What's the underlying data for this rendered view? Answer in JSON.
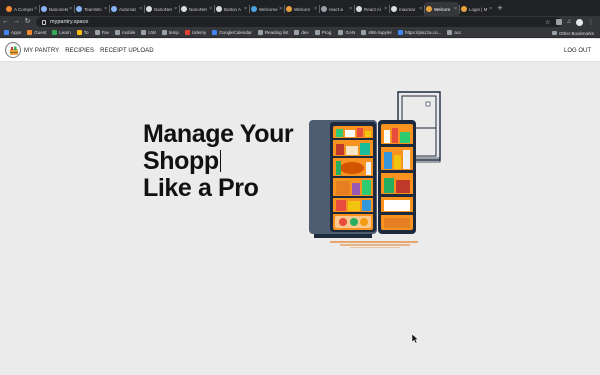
{
  "browser": {
    "tabs": [
      {
        "title": "A Compre",
        "icon": "orange-dot-icon",
        "color": "#f28b30"
      },
      {
        "title": "Nanonets",
        "icon": "nanonets-icon",
        "color": "#8ab4f8"
      },
      {
        "title": "TeamWo",
        "icon": "nanonets-icon",
        "color": "#8ab4f8"
      },
      {
        "title": "Automat",
        "icon": "nanonets-icon",
        "color": "#8ab4f8"
      },
      {
        "title": "NanoNet",
        "icon": "github-icon",
        "color": "#dadce0"
      },
      {
        "title": "NanoNet",
        "icon": "github-icon",
        "color": "#dadce0"
      },
      {
        "title": "Button A",
        "icon": "github-icon",
        "color": "#dadce0"
      },
      {
        "title": "Welcome",
        "icon": "mui-icon",
        "color": "#4aa3df"
      },
      {
        "title": "Welcom",
        "icon": "app-icon",
        "color": "#e8a33d"
      },
      {
        "title": "react-a",
        "icon": "app-icon",
        "color": "#9aa0a6"
      },
      {
        "title": "React Al",
        "icon": "github-icon",
        "color": "#dadce0"
      },
      {
        "title": "maxmar",
        "icon": "github-icon",
        "color": "#dadce0"
      },
      {
        "title": "Welcom",
        "icon": "app-icon",
        "color": "#e8a33d",
        "active": true
      },
      {
        "title": "Login | M",
        "icon": "app-icon",
        "color": "#e8a33d"
      }
    ],
    "url": "mypantry.space",
    "bookmarks": [
      {
        "label": "Apps",
        "color": "#4285f4"
      },
      {
        "label": "Guest",
        "color": "#f28b30"
      },
      {
        "label": "Learn",
        "color": "#34a853"
      },
      {
        "label": "To",
        "color": "#fbbc04"
      },
      {
        "label": "Fav",
        "color": "#9aa0a6"
      },
      {
        "label": "mobile",
        "color": "#9aa0a6"
      },
      {
        "label": "UW",
        "color": "#9aa0a6"
      },
      {
        "label": "temp",
        "color": "#9aa0a6"
      },
      {
        "label": "Udemy",
        "color": "#ea4335"
      },
      {
        "label": "GoogleCalendar",
        "color": "#4285f4"
      },
      {
        "label": "Reading list",
        "color": "#9aa0a6"
      },
      {
        "label": "dev",
        "color": "#9aa0a6"
      },
      {
        "label": "Prog.",
        "color": "#9aa0a6"
      },
      {
        "label": "GAN",
        "color": "#9aa0a6"
      },
      {
        "label": "498-Jupyter",
        "color": "#9aa0a6"
      },
      {
        "label": "https://piazza.co...",
        "color": "#4285f4"
      },
      {
        "label": "acc",
        "color": "#9aa0a6"
      }
    ],
    "other_bookmarks": "Other Bookmarks"
  },
  "app": {
    "nav": {
      "my_pantry": "MY PANTRY",
      "recipes": "RECIPIES",
      "receipt_upload": "RECEIPT UPLOAD",
      "logout": "LOG OUT"
    },
    "hero": {
      "line1": "Manage Your",
      "line2": "Shopp",
      "line3": "Like a Pro"
    }
  },
  "colors": {
    "fridge_body": "#4f5d73",
    "fridge_inner": "#f7931e",
    "fridge_door_outline": "#1d2a3e"
  }
}
